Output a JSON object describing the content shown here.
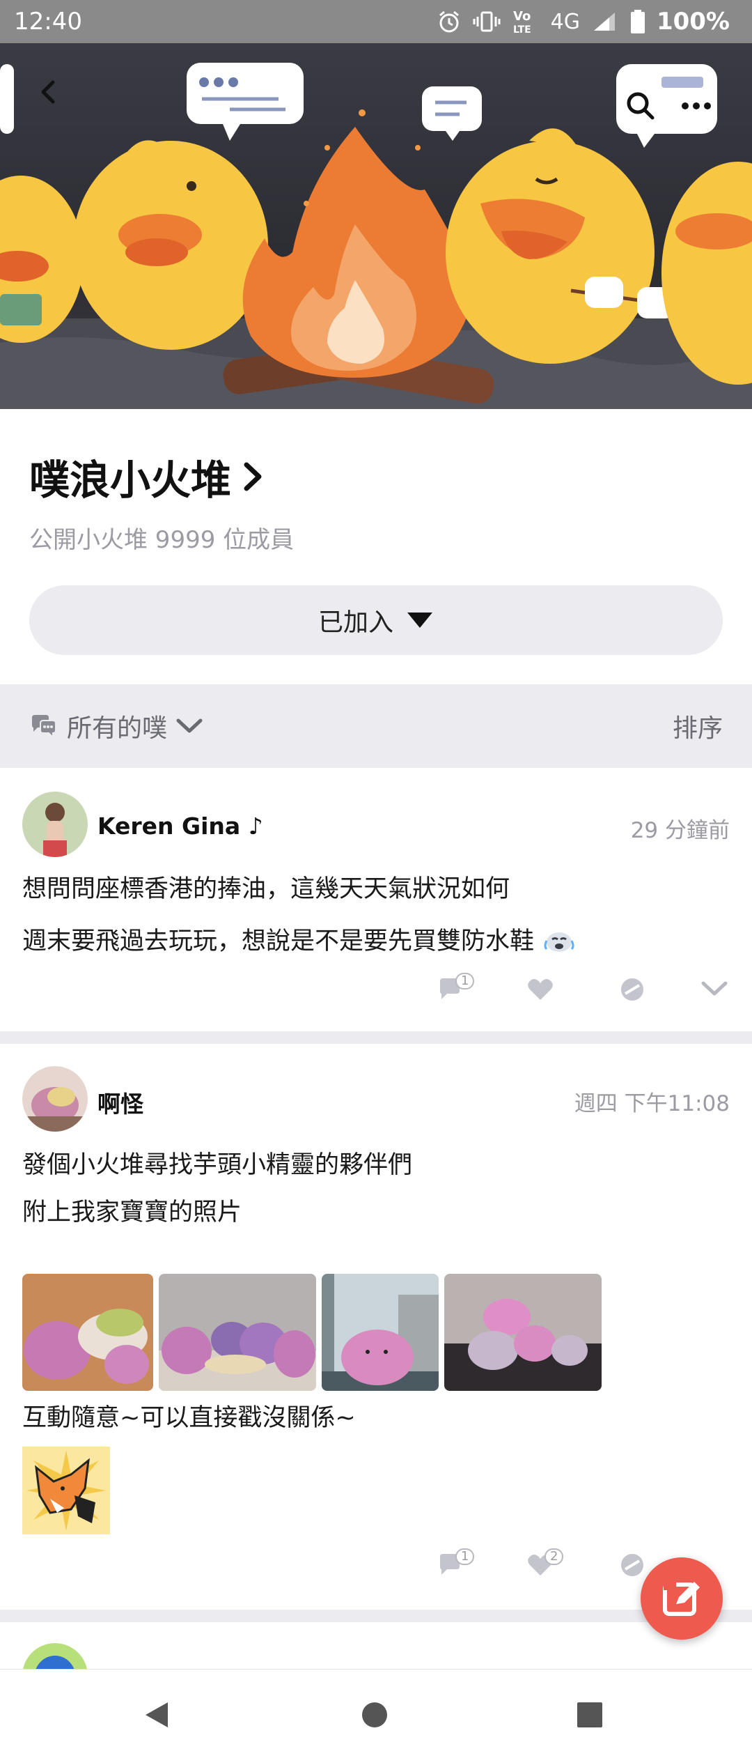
{
  "status_bar": {
    "time": "12:40",
    "network": "4G",
    "battery": "100%",
    "icons": [
      "alarm-icon",
      "vibrate-icon",
      "volte-icon",
      "signal-icon",
      "battery-icon"
    ]
  },
  "header": {
    "back_icon": "back-arrow-icon",
    "search_icon": "search-icon",
    "more_icon": "more-icon"
  },
  "group": {
    "title": "噗浪小火堆",
    "subtitle": "公開小火堆 9999 位成員",
    "join_button": "已加入"
  },
  "filter": {
    "label": "所有的噗",
    "sort": "排序"
  },
  "posts": [
    {
      "author": "Keren Gina ♪",
      "time": "29 分鐘前",
      "lines": [
        "想問問座標香港的捧油，這幾天天氣狀況如何",
        "週末要飛過去玩玩，想說是不是要先買雙防水鞋"
      ],
      "reply_count": "1"
    },
    {
      "author": "啊怪",
      "time": "週四 下午11:08",
      "lines": [
        "發個小火堆尋找芋頭小精靈的夥伴們",
        "附上我家寶寶的照片",
        "互動隨意~可以直接戳沒關係~"
      ],
      "reply_count": "1",
      "like_count": "2"
    }
  ],
  "colors": {
    "accent": "#ef5a4e",
    "muted": "#9b9ba3",
    "background_gray": "#ececf0",
    "status_bar": "#8a8a8a"
  }
}
